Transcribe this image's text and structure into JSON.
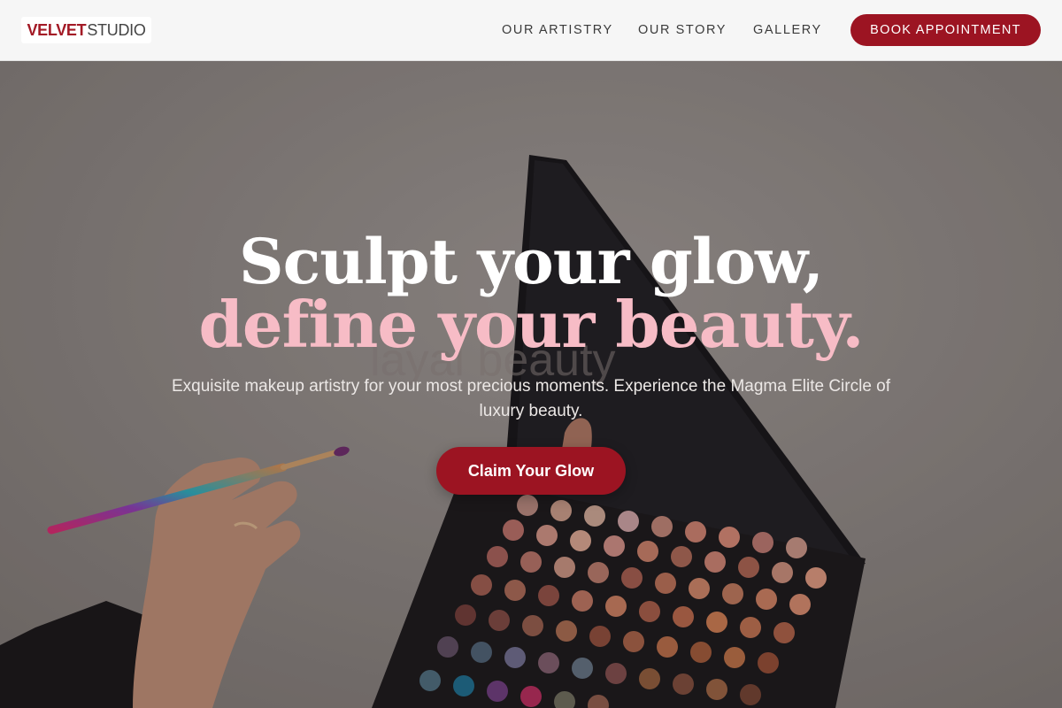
{
  "brand": {
    "logo_part1": "VELVET",
    "logo_part2": "STUDIO",
    "accent_color": "#9c1422",
    "logo_color": "#a31a26"
  },
  "nav": {
    "items": [
      {
        "label": "OUR ARTISTRY"
      },
      {
        "label": "OUR STORY"
      },
      {
        "label": "GALLERY"
      }
    ],
    "book_label": "BOOK APPOINTMENT"
  },
  "hero": {
    "headline_line1": "Sculpt your glow,",
    "headline_line2": "define your beauty.",
    "headline_line2_color": "#f7bcc6",
    "watermark": "layal beauty",
    "subtext": "Exquisite makeup artistry for your most precious moments. Experience the Magma Elite Circle of luxury beauty.",
    "cta_label": "Claim Your Glow"
  }
}
